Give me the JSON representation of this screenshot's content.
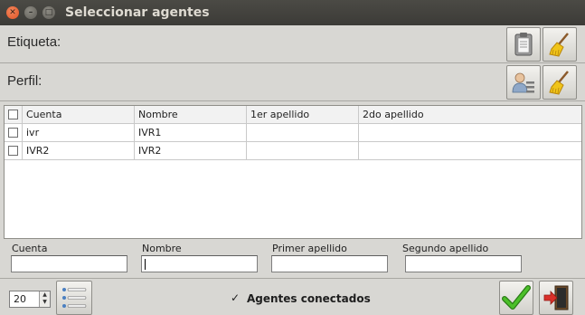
{
  "window": {
    "title": "Seleccionar agentes",
    "close_glyph": "✕",
    "minimize_glyph": "–",
    "maximize_glyph": "□"
  },
  "filters": {
    "tag_label": "Etiqueta:",
    "profile_label": "Perfil:"
  },
  "table": {
    "columns": [
      "Cuenta",
      "Nombre",
      "1er apellido",
      "2do apellido"
    ],
    "rows": [
      {
        "cuenta": "ivr",
        "nombre": "IVR1",
        "apellido1": "",
        "apellido2": "",
        "checked": false
      },
      {
        "cuenta": "IVR2",
        "nombre": "IVR2",
        "apellido1": "",
        "apellido2": "",
        "checked": false
      }
    ]
  },
  "search": {
    "cuenta_label": "Cuenta",
    "nombre_label": "Nombre",
    "primer_label": "Primer apellido",
    "segundo_label": "Segundo apellido",
    "cuenta_value": "",
    "nombre_value": "",
    "primer_value": "",
    "segundo_value": ""
  },
  "footer": {
    "page_size": "20",
    "connected_label": "Agentes conectados",
    "connected_checked": true,
    "check_glyph": "✓"
  },
  "colors": {
    "accent_green": "#3aa521",
    "broom_yellow": "#f0c419",
    "exit_red": "#d9302a"
  },
  "icons": [
    "close-icon",
    "minimize-icon",
    "maximize-icon",
    "clipboard-icon",
    "broom-icon",
    "user-list-icon",
    "list-icon",
    "checkmark-icon",
    "exit-door-icon"
  ]
}
